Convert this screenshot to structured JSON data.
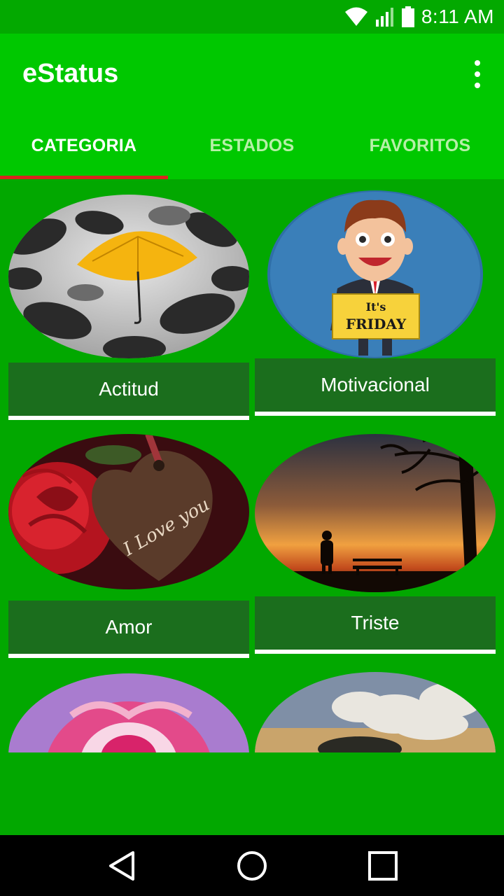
{
  "status_bar": {
    "time": "8:11 AM",
    "icons": [
      "wifi-icon",
      "signal-icon",
      "battery-icon"
    ]
  },
  "app_bar": {
    "title": "eStatus",
    "menu_icon": "more-vertical-icon"
  },
  "tabs": [
    {
      "label": "CATEGORIA",
      "active": true
    },
    {
      "label": "ESTADOS",
      "active": false
    },
    {
      "label": "FAVORITOS",
      "active": false
    }
  ],
  "categories": [
    {
      "label": "Actitud",
      "image": "umbrellas-image"
    },
    {
      "label": "Motivacional",
      "image": "its-friday-image"
    },
    {
      "label": "Amor",
      "image": "heart-rose-image"
    },
    {
      "label": "Triste",
      "image": "sunset-bench-image"
    },
    {
      "label": "",
      "image": "pink-rose-image"
    },
    {
      "label": "",
      "image": "clouds-tree-image"
    }
  ],
  "friday_sign": {
    "line1": "It's",
    "line2": "FRIDAY"
  },
  "heart_text": "I Love you",
  "nav": [
    "back-icon",
    "home-icon",
    "recents-icon"
  ],
  "colors": {
    "app_bar": "#00c800",
    "background": "#02a800",
    "label_bg": "#1b6e1d",
    "tab_indicator": "#d9251d"
  }
}
